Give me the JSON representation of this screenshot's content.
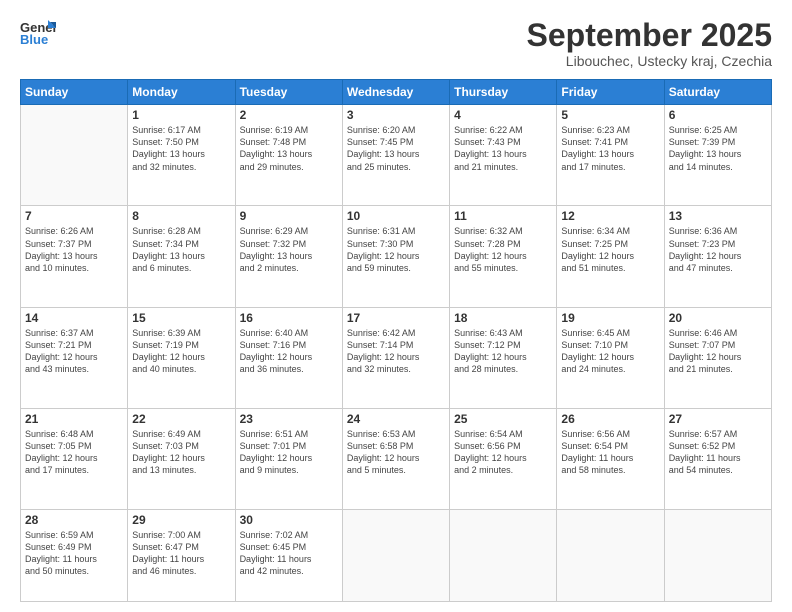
{
  "header": {
    "logo": {
      "general": "General",
      "blue": "Blue"
    },
    "title": "September 2025",
    "location": "Libouchec, Ustecky kraj, Czechia"
  },
  "calendar": {
    "days_of_week": [
      "Sunday",
      "Monday",
      "Tuesday",
      "Wednesday",
      "Thursday",
      "Friday",
      "Saturday"
    ],
    "weeks": [
      [
        {
          "day": "",
          "info": ""
        },
        {
          "day": "1",
          "info": "Sunrise: 6:17 AM\nSunset: 7:50 PM\nDaylight: 13 hours\nand 32 minutes."
        },
        {
          "day": "2",
          "info": "Sunrise: 6:19 AM\nSunset: 7:48 PM\nDaylight: 13 hours\nand 29 minutes."
        },
        {
          "day": "3",
          "info": "Sunrise: 6:20 AM\nSunset: 7:45 PM\nDaylight: 13 hours\nand 25 minutes."
        },
        {
          "day": "4",
          "info": "Sunrise: 6:22 AM\nSunset: 7:43 PM\nDaylight: 13 hours\nand 21 minutes."
        },
        {
          "day": "5",
          "info": "Sunrise: 6:23 AM\nSunset: 7:41 PM\nDaylight: 13 hours\nand 17 minutes."
        },
        {
          "day": "6",
          "info": "Sunrise: 6:25 AM\nSunset: 7:39 PM\nDaylight: 13 hours\nand 14 minutes."
        }
      ],
      [
        {
          "day": "7",
          "info": "Sunrise: 6:26 AM\nSunset: 7:37 PM\nDaylight: 13 hours\nand 10 minutes."
        },
        {
          "day": "8",
          "info": "Sunrise: 6:28 AM\nSunset: 7:34 PM\nDaylight: 13 hours\nand 6 minutes."
        },
        {
          "day": "9",
          "info": "Sunrise: 6:29 AM\nSunset: 7:32 PM\nDaylight: 13 hours\nand 2 minutes."
        },
        {
          "day": "10",
          "info": "Sunrise: 6:31 AM\nSunset: 7:30 PM\nDaylight: 12 hours\nand 59 minutes."
        },
        {
          "day": "11",
          "info": "Sunrise: 6:32 AM\nSunset: 7:28 PM\nDaylight: 12 hours\nand 55 minutes."
        },
        {
          "day": "12",
          "info": "Sunrise: 6:34 AM\nSunset: 7:25 PM\nDaylight: 12 hours\nand 51 minutes."
        },
        {
          "day": "13",
          "info": "Sunrise: 6:36 AM\nSunset: 7:23 PM\nDaylight: 12 hours\nand 47 minutes."
        }
      ],
      [
        {
          "day": "14",
          "info": "Sunrise: 6:37 AM\nSunset: 7:21 PM\nDaylight: 12 hours\nand 43 minutes."
        },
        {
          "day": "15",
          "info": "Sunrise: 6:39 AM\nSunset: 7:19 PM\nDaylight: 12 hours\nand 40 minutes."
        },
        {
          "day": "16",
          "info": "Sunrise: 6:40 AM\nSunset: 7:16 PM\nDaylight: 12 hours\nand 36 minutes."
        },
        {
          "day": "17",
          "info": "Sunrise: 6:42 AM\nSunset: 7:14 PM\nDaylight: 12 hours\nand 32 minutes."
        },
        {
          "day": "18",
          "info": "Sunrise: 6:43 AM\nSunset: 7:12 PM\nDaylight: 12 hours\nand 28 minutes."
        },
        {
          "day": "19",
          "info": "Sunrise: 6:45 AM\nSunset: 7:10 PM\nDaylight: 12 hours\nand 24 minutes."
        },
        {
          "day": "20",
          "info": "Sunrise: 6:46 AM\nSunset: 7:07 PM\nDaylight: 12 hours\nand 21 minutes."
        }
      ],
      [
        {
          "day": "21",
          "info": "Sunrise: 6:48 AM\nSunset: 7:05 PM\nDaylight: 12 hours\nand 17 minutes."
        },
        {
          "day": "22",
          "info": "Sunrise: 6:49 AM\nSunset: 7:03 PM\nDaylight: 12 hours\nand 13 minutes."
        },
        {
          "day": "23",
          "info": "Sunrise: 6:51 AM\nSunset: 7:01 PM\nDaylight: 12 hours\nand 9 minutes."
        },
        {
          "day": "24",
          "info": "Sunrise: 6:53 AM\nSunset: 6:58 PM\nDaylight: 12 hours\nand 5 minutes."
        },
        {
          "day": "25",
          "info": "Sunrise: 6:54 AM\nSunset: 6:56 PM\nDaylight: 12 hours\nand 2 minutes."
        },
        {
          "day": "26",
          "info": "Sunrise: 6:56 AM\nSunset: 6:54 PM\nDaylight: 11 hours\nand 58 minutes."
        },
        {
          "day": "27",
          "info": "Sunrise: 6:57 AM\nSunset: 6:52 PM\nDaylight: 11 hours\nand 54 minutes."
        }
      ],
      [
        {
          "day": "28",
          "info": "Sunrise: 6:59 AM\nSunset: 6:49 PM\nDaylight: 11 hours\nand 50 minutes."
        },
        {
          "day": "29",
          "info": "Sunrise: 7:00 AM\nSunset: 6:47 PM\nDaylight: 11 hours\nand 46 minutes."
        },
        {
          "day": "30",
          "info": "Sunrise: 7:02 AM\nSunset: 6:45 PM\nDaylight: 11 hours\nand 42 minutes."
        },
        {
          "day": "",
          "info": ""
        },
        {
          "day": "",
          "info": ""
        },
        {
          "day": "",
          "info": ""
        },
        {
          "day": "",
          "info": ""
        }
      ]
    ]
  }
}
